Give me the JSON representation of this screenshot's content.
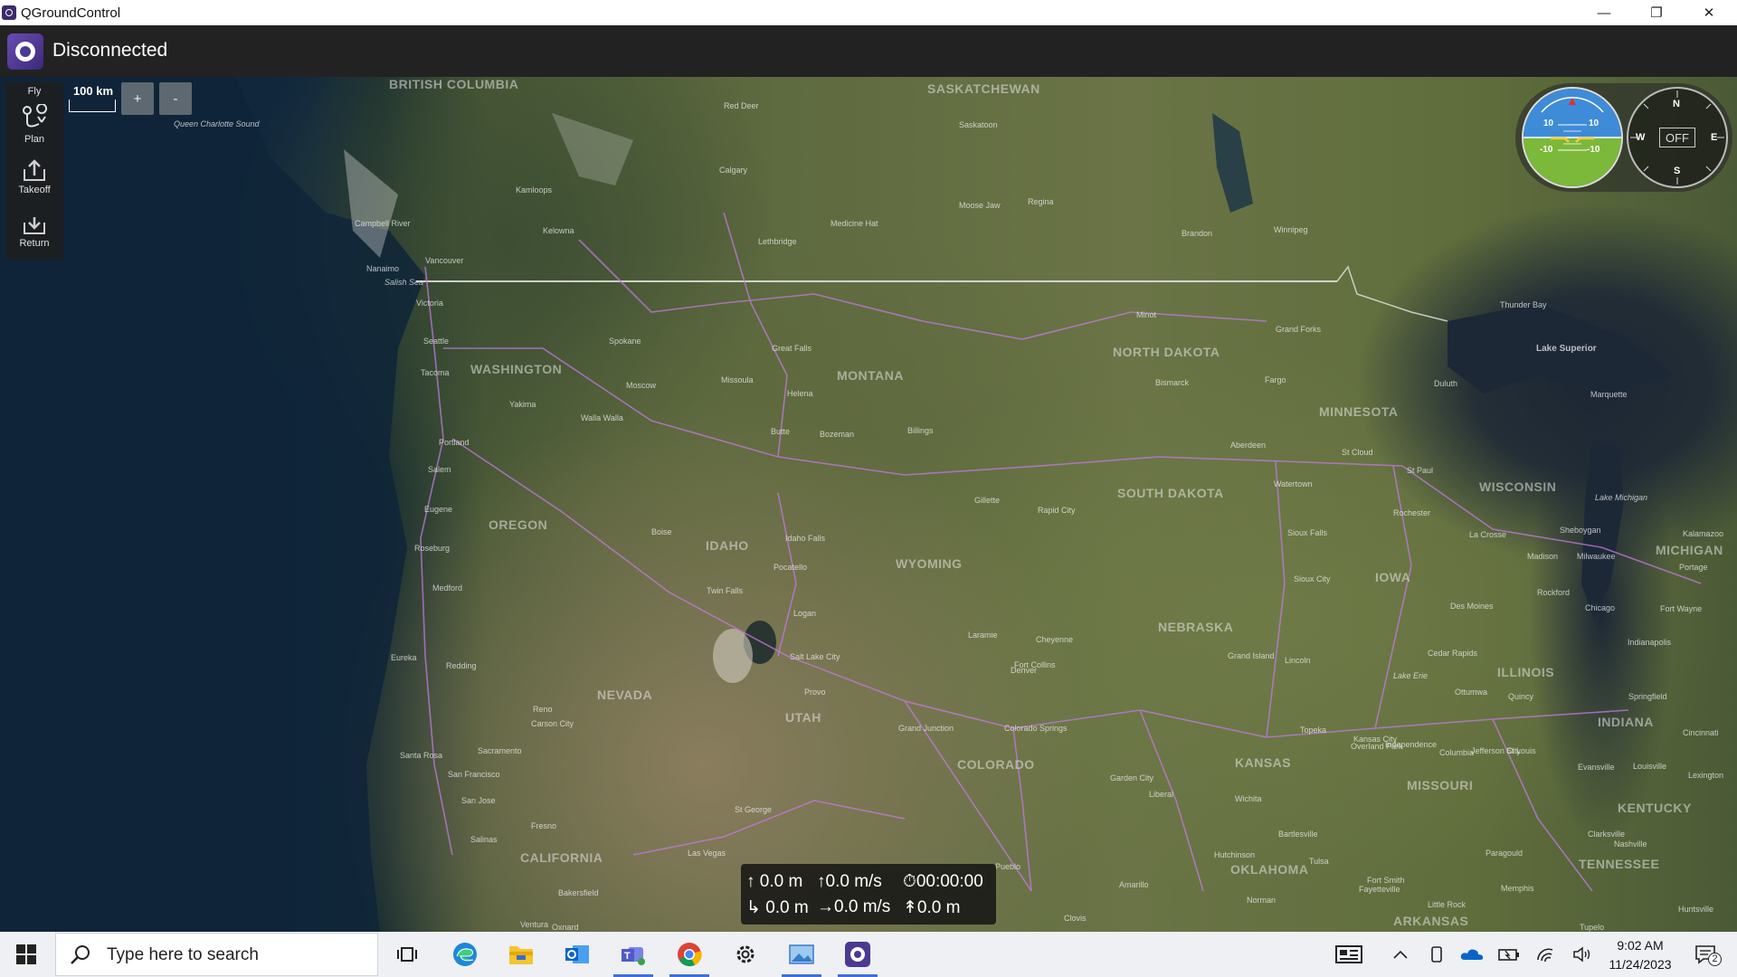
{
  "window": {
    "title": "QGroundControl",
    "controls": {
      "minimize": "—",
      "restore": "❐",
      "close": "✕"
    }
  },
  "toolbar": {
    "connection_status": "Disconnected"
  },
  "toolstrip": {
    "header": "Fly",
    "items": [
      {
        "label": "Plan",
        "icon": "plan-icon"
      },
      {
        "label": "Takeoff",
        "icon": "takeoff-icon"
      },
      {
        "label": "Return",
        "icon": "return-icon"
      }
    ]
  },
  "map": {
    "scale_text": "100 km",
    "zoom_in": "+",
    "zoom_out": "-",
    "regions": [
      "BRITISH COLUMBIA",
      "SASKATCHEWAN",
      "WASHINGTON",
      "MONTANA",
      "NORTH DAKOTA",
      "MINNESOTA",
      "OREGON",
      "IDAHO",
      "WYOMING",
      "SOUTH DAKOTA",
      "WISCONSIN",
      "MICHIGAN",
      "IOWA",
      "NEBRASKA",
      "NEVADA",
      "UTAH",
      "COLORADO",
      "KANSAS",
      "MISSOURI",
      "ILLINOIS",
      "INDIANA",
      "KENTUCKY",
      "TENNESSEE",
      "CALIFORNIA",
      "OKLAHOMA",
      "ARKANSAS"
    ],
    "water_labels": [
      "Lake Superior",
      "Salish Sea",
      "Queen Charlotte Sound",
      "Lake Michigan",
      "Lake Erie"
    ],
    "cities": [
      "Red Deer",
      "Saskatoon",
      "Calgary",
      "Kamloops",
      "Kelowna",
      "Medicine Hat",
      "Moose Jaw",
      "Regina",
      "Lethbridge",
      "Brandon",
      "Winnipeg",
      "Vancouver",
      "Victoria",
      "Nanaimo",
      "Campbell River",
      "Seattle",
      "Tacoma",
      "Spokane",
      "Great Falls",
      "Missoula",
      "Helena",
      "Minot",
      "Grand Forks",
      "Thunder Bay",
      "Duluth",
      "Marquette",
      "Fargo",
      "Bismarck",
      "Portland",
      "Salem",
      "Eugene",
      "Yakima",
      "Walla Walla",
      "Moscow",
      "Butte",
      "Bozeman",
      "Billings",
      "Aberdeen",
      "Watertown",
      "St Cloud",
      "St Paul",
      "Rochester",
      "Medford",
      "Roseburg",
      "Boise",
      "Idaho Falls",
      "Pocatello",
      "Twin Falls",
      "Gillette",
      "Rapid City",
      "Sioux Falls",
      "Sioux City",
      "La Crosse",
      "Madison",
      "Milwaukee",
      "Sheboygan",
      "Rockford",
      "Chicago",
      "Eureka",
      "Redding",
      "Logan",
      "Salt Lake City",
      "Provo",
      "Cheyenne",
      "Fort Collins",
      "Laramie",
      "Denver",
      "Grand Island",
      "Lincoln",
      "Des Moines",
      "Cedar Rapids",
      "Ottumwa",
      "Quincy",
      "Springfield",
      "Indianapolis",
      "Fort Wayne",
      "Portage",
      "Kalamazoo",
      "Santa Rosa",
      "San Francisco",
      "San Jose",
      "Sacramento",
      "Carson City",
      "Reno",
      "Grand Junction",
      "Colorado Springs",
      "Topeka",
      "Kansas City",
      "Independence",
      "Columbia",
      "Jefferson City",
      "St Louis",
      "Evansville",
      "Louisville",
      "Garden City",
      "Wichita",
      "Fresno",
      "Salinas",
      "Bakersfield",
      "Las Vegas",
      "St George",
      "Amarillo",
      "Tulsa",
      "Fayetteville",
      "Fort Smith",
      "Memphis",
      "Nashville",
      "Paragould",
      "Clovis",
      "Norman",
      "Ventura",
      "Oxnard",
      "Little Rock",
      "Pueblo",
      "Liberal",
      "Bartlesville",
      "Overland Park",
      "Clarksville",
      "Huntsville",
      "Lexington",
      "Cincinnati",
      "Tupelo",
      "Hutchinson"
    ]
  },
  "instruments": {
    "pitch_up_left": "10",
    "pitch_up_right": "10",
    "pitch_down_left": "-10",
    "pitch_down_right": "-10",
    "compass_n": "N",
    "compass_s": "S",
    "compass_e": "E",
    "compass_w": "W",
    "heading": "OFF"
  },
  "telemetry": {
    "altitude": "0.0 m",
    "vertical_speed": "0.0 m/s",
    "flight_time": "00:00:00",
    "distance_home": "0.0 m",
    "ground_speed": "0.0 m/s",
    "distance_waypoint": "0.0 m"
  },
  "taskbar": {
    "search_placeholder": "Type here to search",
    "apps": [
      "task-view-icon",
      "edge-icon",
      "file-explorer-icon",
      "outlook-icon",
      "teams-icon",
      "chrome-icon",
      "settings-icon",
      "photos-icon",
      "qgroundcontrol-icon"
    ],
    "time": "9:02 AM",
    "date": "11/24/2023",
    "notification_count": "2",
    "colors": {
      "active_underline": "#3f6fd8",
      "taskbar_bg": "#eef0f4"
    }
  }
}
